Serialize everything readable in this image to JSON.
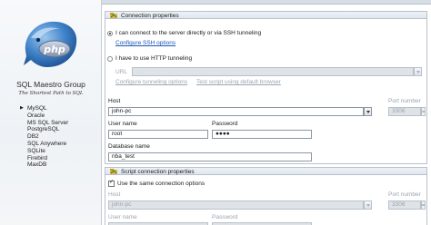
{
  "sidebar": {
    "company": "SQL Maestro Group",
    "tagline": "The Shortest Path to SQL",
    "logo_text": "php",
    "databases": [
      "MySQL",
      "Oracle",
      "MS SQL Server",
      "PostgreSQL",
      "DB2",
      "SQL Anywhere",
      "SQLite",
      "Firebird",
      "MaxDB"
    ],
    "selected_index": 0
  },
  "connection": {
    "title": "Connection properties",
    "radio_direct": "I can connect to the server directly or via SSH tunneling",
    "radio_direct_selected": true,
    "configure_ssh": "Configure SSH options",
    "radio_http": "I have to use HTTP tunneling",
    "url_label": "URL",
    "url_value": "",
    "configure_tunneling": "Configure tunneling options",
    "test_script": "Test script using default browser",
    "host_label": "Host",
    "host_value": "john-pc",
    "port_label": "Port number",
    "port_value": "3306",
    "user_label": "User name",
    "user_value": "root",
    "password_label": "Password",
    "password_value": "●●●●",
    "db_label": "Database name",
    "db_value": "nba_test"
  },
  "script": {
    "title": "Script connection properties",
    "same_label": "Use the same connection options",
    "same_checked": true,
    "host_label": "Host",
    "host_value": "john-pc",
    "port_label": "Port number",
    "port_value": "3306",
    "user_label": "User name",
    "password_label": "Password"
  },
  "colors": {
    "link": "#1a57b8",
    "disabled_text": "#9aa4b0",
    "disabled_field": "#dfe3e8"
  }
}
